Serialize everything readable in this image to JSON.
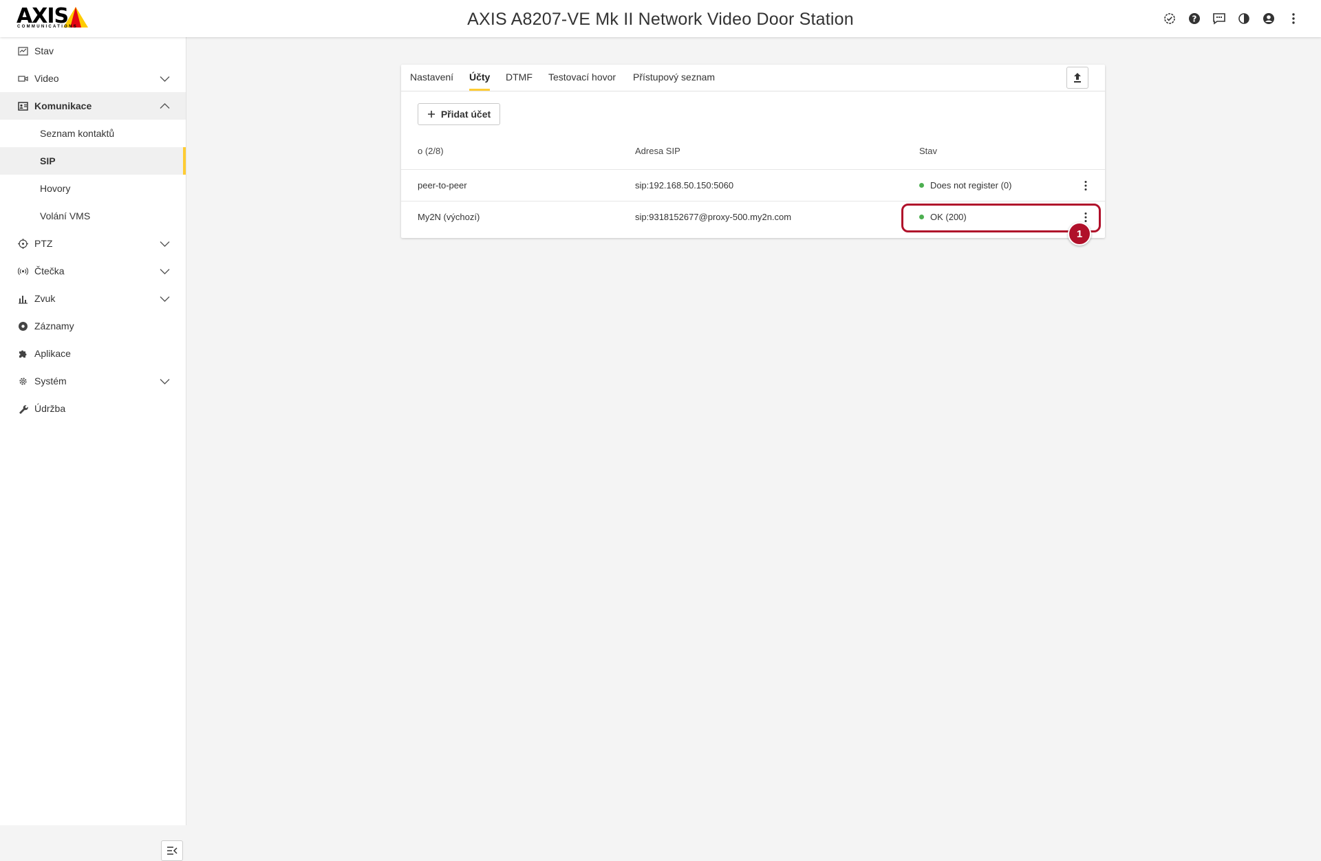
{
  "header": {
    "logo_text": "AXIS",
    "logo_sub": "COMMUNICATIONS",
    "title": "AXIS A8207-VE Mk II Network Video Door Station",
    "icons": [
      "status-check-icon",
      "help-icon",
      "feedback-icon",
      "contrast-icon",
      "account-icon",
      "more-vertical-icon"
    ]
  },
  "sidebar": {
    "items": [
      {
        "label": "Stav",
        "icon": "status-icon"
      },
      {
        "label": "Video",
        "icon": "video-icon"
      },
      {
        "label": "Komunikace",
        "icon": "communication-icon"
      },
      {
        "label": "Seznam kontaktů"
      },
      {
        "label": "SIP"
      },
      {
        "label": "Hovory"
      },
      {
        "label": "Volání VMS"
      },
      {
        "label": "PTZ",
        "icon": "ptz-icon"
      },
      {
        "label": "Čtečka",
        "icon": "reader-icon"
      },
      {
        "label": "Zvuk",
        "icon": "audio-icon"
      },
      {
        "label": "Záznamy",
        "icon": "recordings-icon"
      },
      {
        "label": "Aplikace",
        "icon": "apps-icon"
      },
      {
        "label": "Systém",
        "icon": "system-icon"
      },
      {
        "label": "Údržba",
        "icon": "maintenance-icon"
      }
    ]
  },
  "tabs": [
    "Nastavení",
    "Účty",
    "DTMF",
    "Testovací hovor",
    "Přístupový seznam"
  ],
  "active_tab": "Účty",
  "add_button": "Přidat účet",
  "table": {
    "headers": [
      "o (2/8)",
      "Adresa SIP",
      "Stav"
    ],
    "rows": [
      {
        "name": "peer-to-peer",
        "address": "sip:192.168.50.150:5060",
        "status": "Does not register (0)"
      },
      {
        "name": "My2N (výchozí)",
        "address": "sip:9318152677@proxy-500.my2n.com",
        "status": "OK (200)"
      }
    ]
  },
  "annotation": {
    "badge": "1",
    "color": "#b0102a"
  },
  "colors": {
    "accent": "#ffcc33",
    "status_ok": "#4caf50"
  }
}
